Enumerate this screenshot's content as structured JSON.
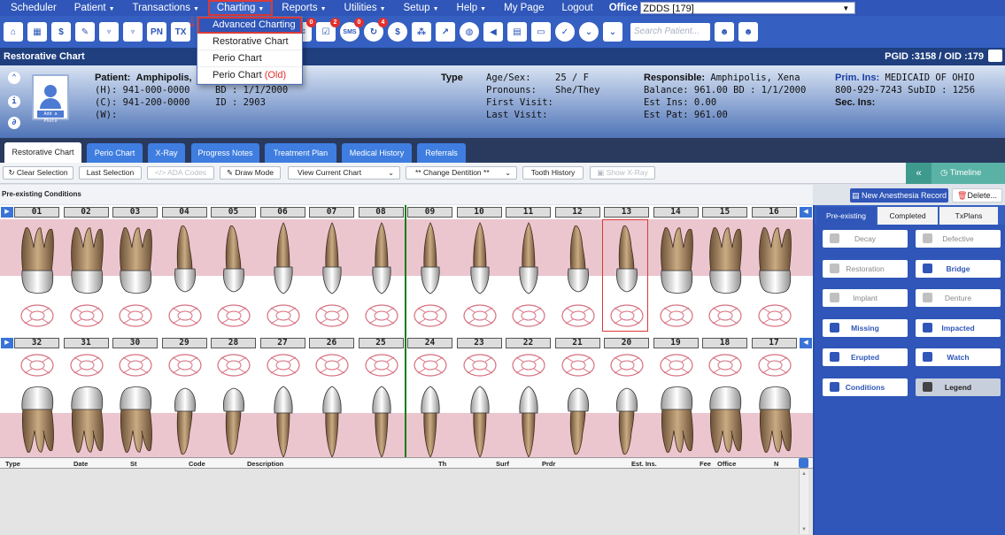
{
  "menu": {
    "items": [
      {
        "label": "Scheduler",
        "caret": false
      },
      {
        "label": "Patient",
        "caret": true
      },
      {
        "label": "Transactions",
        "caret": true
      },
      {
        "label": "Charting",
        "caret": true
      },
      {
        "label": "Reports",
        "caret": true
      },
      {
        "label": "Utilities",
        "caret": true
      },
      {
        "label": "Setup",
        "caret": true
      },
      {
        "label": "Help",
        "caret": true
      },
      {
        "label": "My Page",
        "caret": false
      },
      {
        "label": "Logout",
        "caret": false
      }
    ],
    "office_label": "Office",
    "office_value": "ZDDS [179]"
  },
  "charting_dropdown": {
    "items": [
      "Advanced Charting",
      "Restorative Chart",
      "Perio Chart"
    ],
    "old_item_label": "Perio Chart",
    "old_item_suffix": "(Old)"
  },
  "toolbar_icons": [
    "home-icon",
    "calendar-icon",
    "dollar-icon",
    "edit-icon",
    "tooth-icon",
    "tooth-icon-2",
    "pn-icon",
    "tx-icon"
  ],
  "toolbar_icon_text": {
    "pn": "PN",
    "tx": "TX",
    "sms": "SMS"
  },
  "badges": {
    "b1": "0",
    "b2": "2",
    "b3": "0",
    "b4": "4"
  },
  "search": {
    "placeholder": "Search Patient..."
  },
  "page": {
    "title": "Restorative Chart",
    "pgid": "PGID :3158  /  OID :179"
  },
  "patient": {
    "patient_label": "Patient:",
    "name": "Amphipolis,",
    "home_phone": "(H): 941-000-0000",
    "cell_phone": "(C):  941-200-0000",
    "work_phone": "(W):",
    "bd": "BD : 1/1/2000",
    "id": "ID : 2903",
    "type_label": "Type",
    "age_sex_label": "Age/Sex:",
    "age_sex": "25 / F",
    "pronouns_label": "Pronouns:",
    "pronouns": "She/They",
    "first_visit_label": "First Visit:",
    "last_visit_label": "Last Visit:",
    "responsible_label": "Responsible:",
    "responsible": "Amphipolis, Xena",
    "balance": "Balance: 961.00   BD : 1/1/2000",
    "est_ins": "Est Ins:  0.00",
    "est_pat": "Est Pat: 961.00",
    "prim_ins_label": "Prim. Ins:",
    "prim_ins": "MEDICAID OF OHIO",
    "ins_phone": "800-929-7243 SubID : 1256",
    "sec_ins_label": "Sec. Ins:",
    "add_photo": "Add a Photo"
  },
  "tabs": [
    "Restorative Chart",
    "Perio Chart",
    "X-Ray",
    "Progress Notes",
    "Treatment Plan",
    "Medical History",
    "Referrals"
  ],
  "chart_toolbar": {
    "clear_selection": "Clear Selection",
    "last_selection": "Last Selection",
    "ada_codes": "ADA Codes",
    "draw_mode": "Draw Mode",
    "view_chart": "View Current Chart",
    "change_dentition": "** Change Dentition **",
    "tooth_history": "Tooth History",
    "show_xray": "Show X-Ray",
    "timeline": "Timeline"
  },
  "section": {
    "title": "Pre-existing Conditions",
    "new_anesthesia": "New Anesthesia Record",
    "delete": "Delete..."
  },
  "teeth": {
    "upper": [
      "01",
      "02",
      "03",
      "04",
      "05",
      "06",
      "07",
      "08",
      "09",
      "10",
      "11",
      "12",
      "13",
      "14",
      "15",
      "16"
    ],
    "lower": [
      "32",
      "31",
      "30",
      "29",
      "28",
      "27",
      "26",
      "25",
      "24",
      "23",
      "22",
      "21",
      "20",
      "19",
      "18",
      "17"
    ],
    "selected": "13"
  },
  "procedure_table": {
    "columns": [
      "Type",
      "Date",
      "St",
      "Code",
      "Description",
      "Th",
      "Surf",
      "Prdr",
      "Est. Ins.",
      "Fee",
      "Office",
      "N"
    ]
  },
  "right_panel": {
    "tabs": [
      "Pre-existing",
      "Completed",
      "TxPlans"
    ],
    "buttons": [
      {
        "label": "Decay",
        "style": "plain",
        "icon": "decay-icon"
      },
      {
        "label": "Defective",
        "style": "plain",
        "icon": "defective-icon"
      },
      {
        "label": "Restoration",
        "style": "plain",
        "icon": "restoration-icon"
      },
      {
        "label": "Bridge",
        "style": "bold",
        "icon": "bridge-icon"
      },
      {
        "label": "Implant",
        "style": "plain",
        "icon": "implant-icon"
      },
      {
        "label": "Denture",
        "style": "plain",
        "icon": "denture-icon"
      },
      {
        "label": "Missing",
        "style": "bold",
        "icon": "missing-icon"
      },
      {
        "label": "Impacted",
        "style": "bold",
        "icon": "impacted-icon"
      },
      {
        "label": "Erupted",
        "style": "bold",
        "icon": "erupted-icon"
      },
      {
        "label": "Watch",
        "style": "bold",
        "icon": "watch-icon"
      },
      {
        "label": "Conditions",
        "style": "bold",
        "icon": "conditions-icon"
      },
      {
        "label": "Legend",
        "style": "legend",
        "icon": "legend-icon"
      }
    ]
  },
  "colors": {
    "menu": "#2f56b8",
    "accent": "#3f7ee0",
    "band": "#ecc6cf",
    "midline": "#0a7a1a",
    "selection": "#d93a3a"
  }
}
